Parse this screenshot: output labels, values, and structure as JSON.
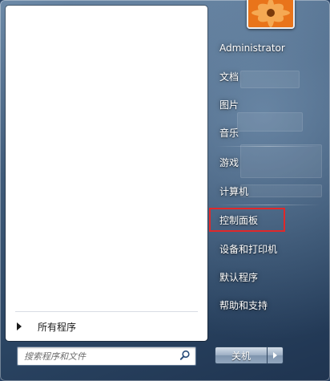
{
  "left_pane": {
    "all_programs_label": "所有程序"
  },
  "search": {
    "placeholder": "搜索程序和文件"
  },
  "right_pane": {
    "items": [
      {
        "label": "Administrator"
      },
      {
        "label": "文档"
      },
      {
        "label": "图片"
      },
      {
        "label": "音乐"
      },
      {
        "label": "游戏"
      },
      {
        "label": "计算机"
      },
      {
        "label": "控制面板"
      },
      {
        "label": "设备和打印机"
      },
      {
        "label": "默认程序"
      },
      {
        "label": "帮助和支持"
      }
    ],
    "highlighted_item": "控制面板"
  },
  "shutdown": {
    "label": "关机"
  },
  "colors": {
    "highlight_border": "#e0282a",
    "glass": "#3f5b7a"
  },
  "icons": [
    "user-picture-flower",
    "search-icon",
    "arrow-right-icon",
    "chevron-right-icon"
  ]
}
